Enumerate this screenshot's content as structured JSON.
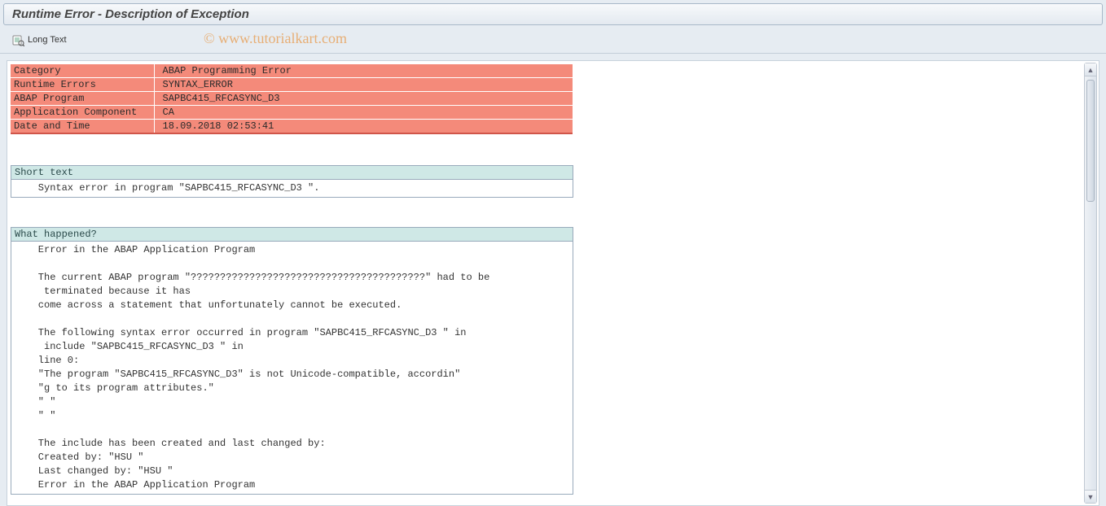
{
  "header": {
    "title": "Runtime Error - Description of Exception"
  },
  "toolbar": {
    "long_text_label": "Long Text"
  },
  "watermark": "© www.tutorialkart.com",
  "error_info": {
    "rows": [
      {
        "label": "Category",
        "value": "ABAP Programming Error"
      },
      {
        "label": "Runtime Errors",
        "value": "SYNTAX_ERROR"
      },
      {
        "label": "ABAP Program",
        "value": "SAPBC415_RFCASYNC_D3"
      },
      {
        "label": "Application Component",
        "value": "CA"
      },
      {
        "label": "Date and Time",
        "value": "18.09.2018 02:53:41"
      }
    ]
  },
  "sections": [
    {
      "title": "Short text",
      "lines": [
        "    Syntax error in program \"SAPBC415_RFCASYNC_D3 \"."
      ]
    },
    {
      "title": "What happened?",
      "lines": [
        "    Error in the ABAP Application Program",
        "",
        "    The current ABAP program \"????????????????????????????????????????\" had to be",
        "     terminated because it has",
        "    come across a statement that unfortunately cannot be executed.",
        "",
        "    The following syntax error occurred in program \"SAPBC415_RFCASYNC_D3 \" in",
        "     include \"SAPBC415_RFCASYNC_D3 \" in",
        "    line 0:",
        "    \"The program \"SAPBC415_RFCASYNC_D3\" is not Unicode-compatible, accordin\"",
        "    \"g to its program attributes.\"",
        "    \" \"",
        "    \" \"",
        "",
        "    The include has been created and last changed by:",
        "    Created by: \"HSU \"",
        "    Last changed by: \"HSU \"",
        "    Error in the ABAP Application Program"
      ]
    }
  ]
}
